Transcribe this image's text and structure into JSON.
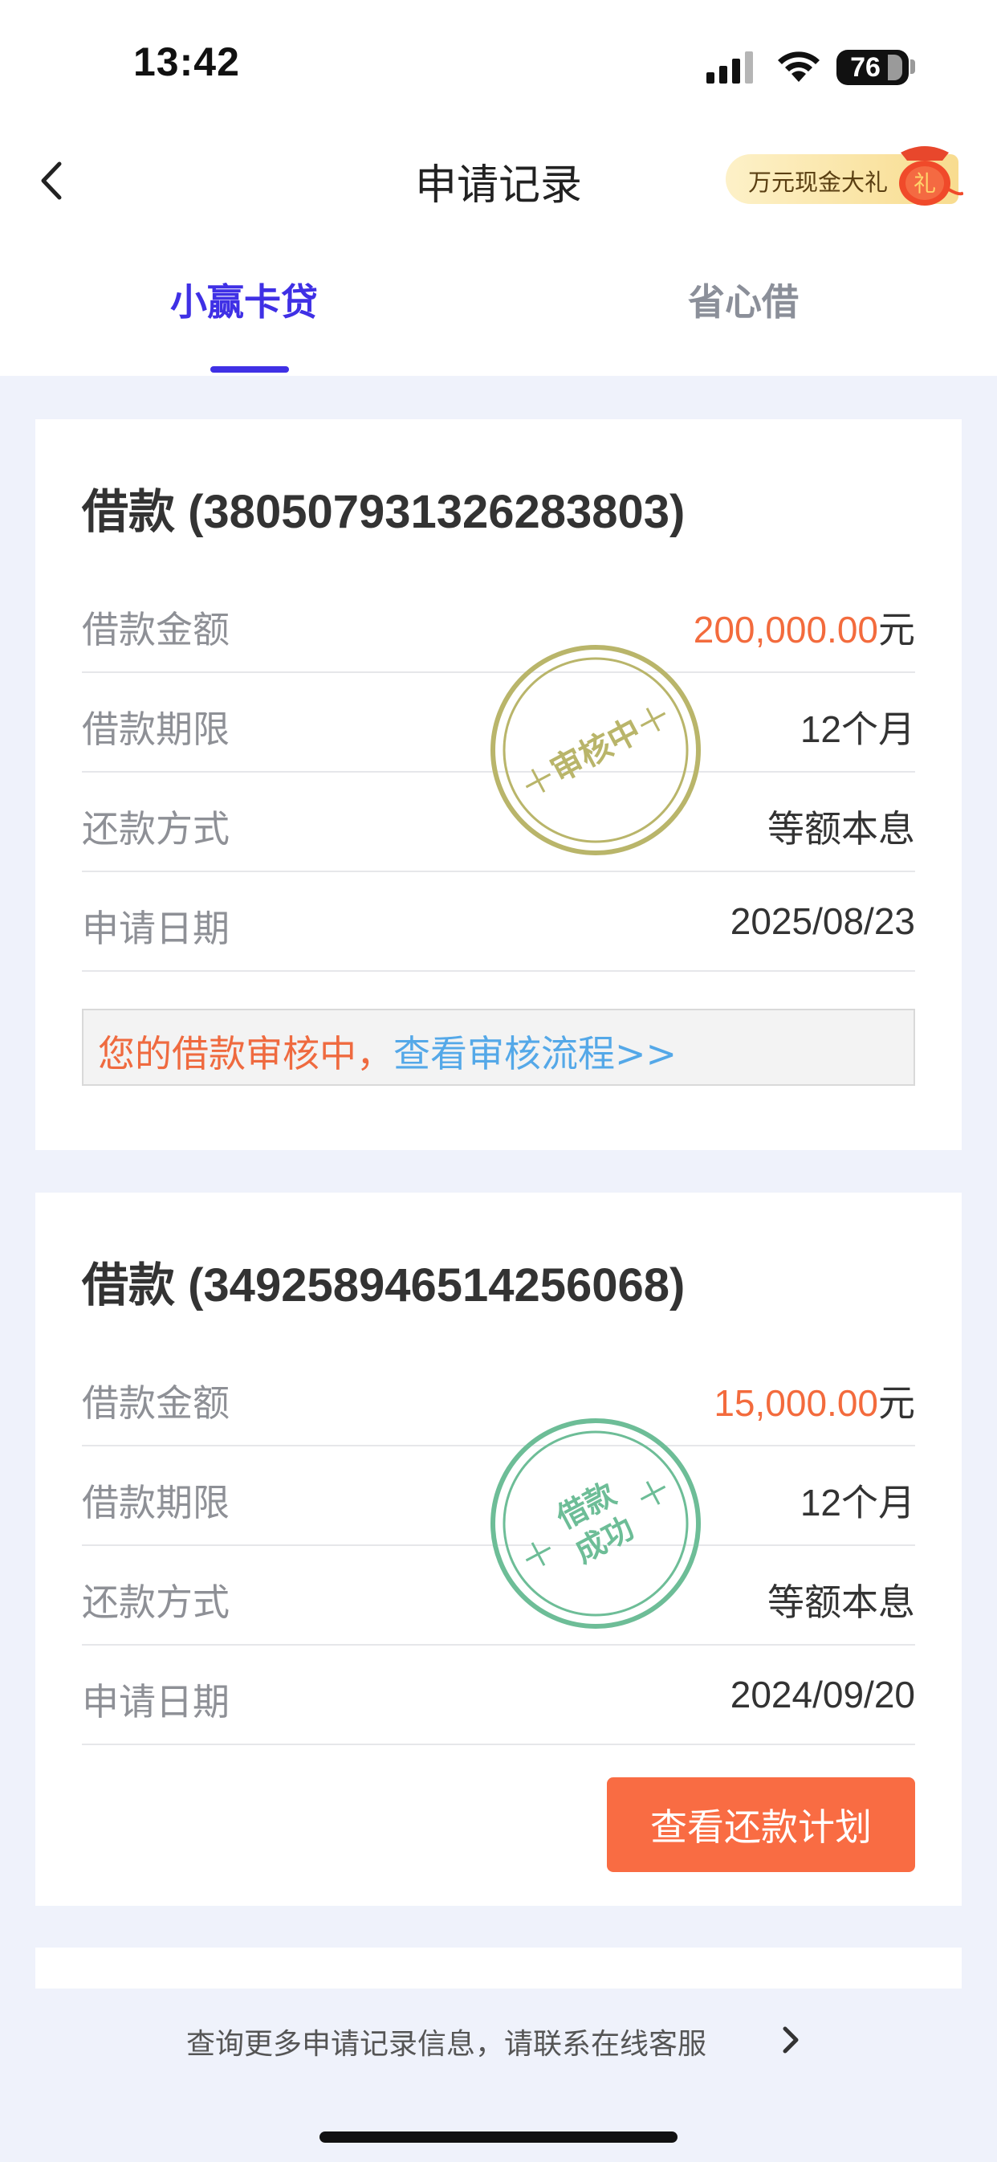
{
  "status_bar": {
    "time": "13:42",
    "battery": "76"
  },
  "header": {
    "title": "申请记录",
    "promo_text": "万元现金大礼",
    "promo_badge": "礼"
  },
  "tabs": [
    {
      "label": "小赢卡贷",
      "active": true
    },
    {
      "label": "省心借",
      "active": false
    }
  ],
  "loans": [
    {
      "title": "借款 (380507931326283803)",
      "rows": [
        {
          "label": "借款金额",
          "amount": "200,000.00",
          "unit": "元"
        },
        {
          "label": "借款期限",
          "value": "12个月"
        },
        {
          "label": "还款方式",
          "value": "等额本息"
        },
        {
          "label": "申请日期",
          "value": "2025/08/23"
        }
      ],
      "stamp_text": "审核中",
      "notice_text": "您的借款审核中，",
      "notice_link": "查看审核流程>>"
    },
    {
      "title": "借款 (349258946514256068)",
      "rows": [
        {
          "label": "借款金额",
          "amount": "15,000.00",
          "unit": "元"
        },
        {
          "label": "借款期限",
          "value": "12个月"
        },
        {
          "label": "还款方式",
          "value": "等额本息"
        },
        {
          "label": "申请日期",
          "value": "2024/09/20"
        }
      ],
      "stamp_line1": "借款",
      "stamp_line2": "成功",
      "button_label": "查看还款计划"
    }
  ],
  "footer": {
    "text": "查询更多申请记录信息，请联系在线客服"
  },
  "colors": {
    "accent": "#3f30e5",
    "amount": "#f36b3d",
    "button": "#f96c43",
    "link": "#54a8e8",
    "stamp_pending": "#b9b56a",
    "stamp_success": "#6dbd97"
  }
}
